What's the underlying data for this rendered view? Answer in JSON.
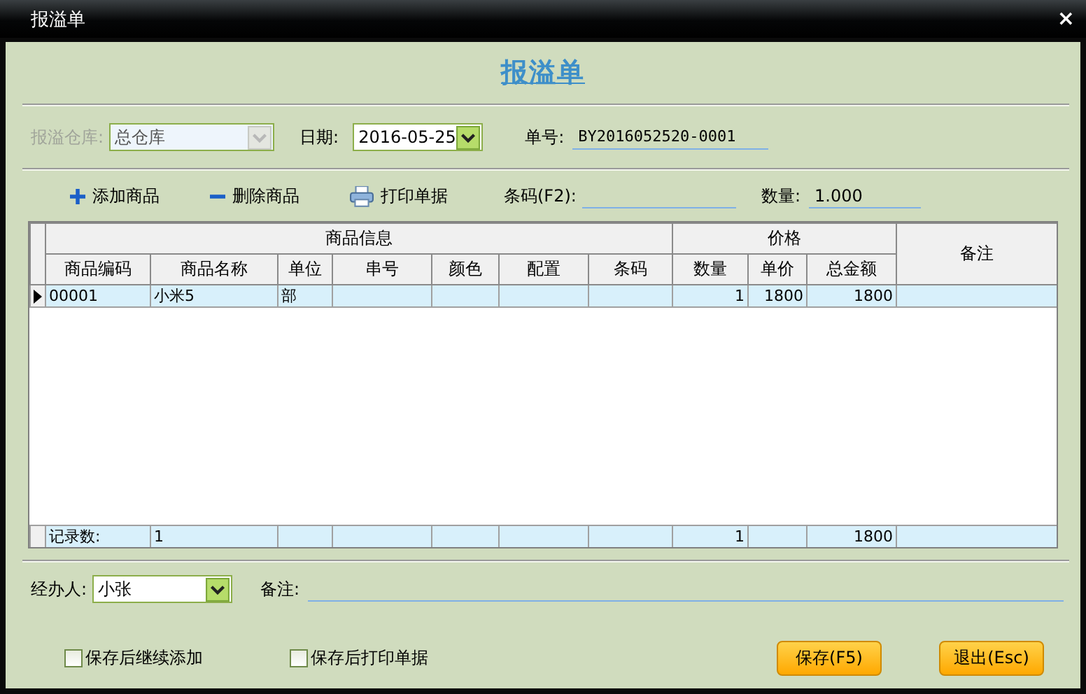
{
  "window": {
    "title": "报溢单",
    "close": "×"
  },
  "heading": "报溢单",
  "form": {
    "warehouse": {
      "label": "报溢仓库:",
      "value": "总仓库",
      "disabled": true
    },
    "date": {
      "label": "日期:",
      "value": "2016-05-25"
    },
    "number": {
      "label": "单号:",
      "value": "BY2016052520-0001"
    }
  },
  "toolbar": {
    "actions": [
      {
        "label": "添加商品",
        "kind": "add"
      },
      {
        "label": "删除商品",
        "kind": "delete"
      },
      {
        "label": "打印单据",
        "kind": "print"
      }
    ],
    "barcode": {
      "label": "条码(F2):"
    },
    "quantity": {
      "label": "数量:",
      "value": "1.000"
    }
  },
  "table": {
    "groups": [
      {
        "label": "商品信息",
        "columns": [
          "商品编码",
          "商品名称",
          "单位",
          "串号",
          "颜色",
          "配置",
          "条码"
        ]
      },
      {
        "label": "价格",
        "columns": [
          "数量",
          "单价",
          "总金额"
        ]
      },
      {
        "label": "备注"
      }
    ],
    "rows": [
      {
        "selected": true,
        "code": "00001",
        "name": "小米5",
        "unit": "部",
        "quantity": "1",
        "price": "1800",
        "total": "1800"
      }
    ],
    "footer": {
      "label": "记录数:",
      "count": "1",
      "quantity": "1",
      "total": "1800"
    }
  },
  "bottom": {
    "handler": {
      "label": "经办人:",
      "value": "小张"
    },
    "remark": {
      "label": "备注:"
    },
    "checkboxes": [
      {
        "label": "保存后继续添加",
        "checked": false
      },
      {
        "label": "保存后打印单据",
        "checked": false
      }
    ],
    "buttons": [
      "保存(F5)",
      "退出(Esc)"
    ]
  }
}
